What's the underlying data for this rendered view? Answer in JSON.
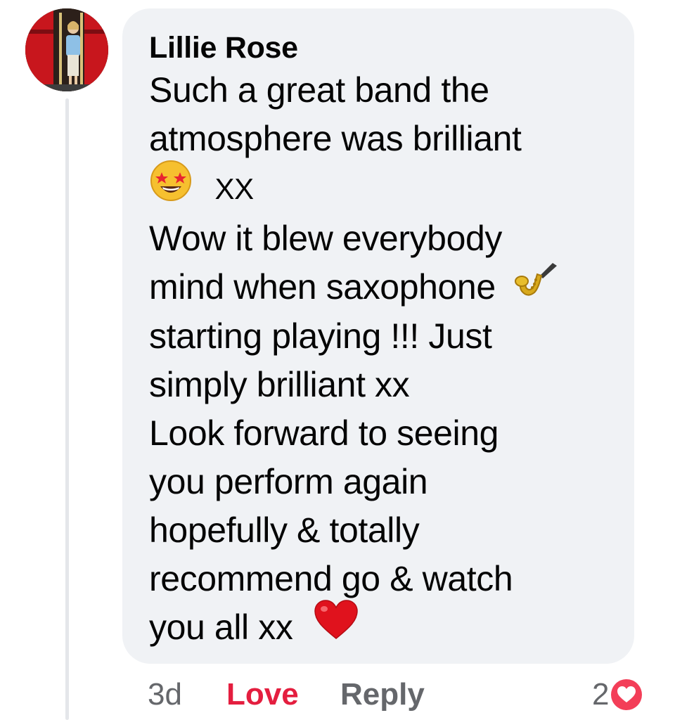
{
  "comment": {
    "author": "Lillie Rose",
    "lines": [
      "Such a great band the",
      "atmosphere was brilliant",
      "XX",
      "Wow it blew everybody",
      "mind when saxophone",
      "starting playing !!! Just",
      "simply brilliant xx",
      "Look forward to seeing",
      "you perform again",
      "hopefully & totally",
      "recommend go & watch",
      "you all xx"
    ],
    "emojis": {
      "star_struck": "star-struck-emoji",
      "saxophone": "saxophone-emoji",
      "heart": "red-heart-emoji"
    }
  },
  "actions": {
    "time": "3d",
    "love_label": "Love",
    "reply_label": "Reply"
  },
  "reactions": {
    "count": "2",
    "icon": "heart-reaction-icon"
  },
  "colors": {
    "bubble": "#f0f2f5",
    "text": "#050505",
    "muted": "#65676b",
    "love": "#e41e3f",
    "thread_line": "#e4e6ea"
  }
}
